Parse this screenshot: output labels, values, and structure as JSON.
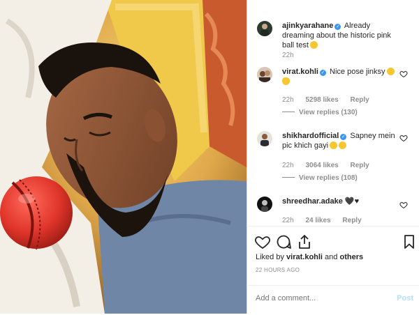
{
  "caption": {
    "username": "ajinkyarahane",
    "text": "Already dreaming about the historic pink ball test",
    "time": "22h"
  },
  "comments": [
    {
      "username": "virat.kohli",
      "text": "Nice pose jinksy",
      "time": "22h",
      "likes": "5298 likes",
      "reply": "Reply",
      "view_replies": "View replies (130)"
    },
    {
      "username": "shikhardofficial",
      "text": "Sapney mein pic khich gayi",
      "time": "22h",
      "likes": "3064 likes",
      "reply": "Reply",
      "view_replies": "View replies (108)"
    },
    {
      "username": "shreedhar.adake",
      "text": "🖤♥",
      "time": "22h",
      "likes": "24 likes",
      "reply": "Reply"
    }
  ],
  "liked_by": {
    "prefix": "Liked by ",
    "user": "virat.kohli",
    "middle": " and ",
    "others": "others"
  },
  "timestamp": "22 HOURS AGO",
  "add_comment": {
    "placeholder": "Add a comment...",
    "post_label": "Post"
  },
  "icons": [
    "verified-badge-icon",
    "heart-icon",
    "comment-icon",
    "share-icon",
    "bookmark-icon"
  ],
  "colors": {
    "verified": "#3897f0",
    "post_button": "#b2dffc",
    "secondary_text": "#8e8e8e"
  }
}
